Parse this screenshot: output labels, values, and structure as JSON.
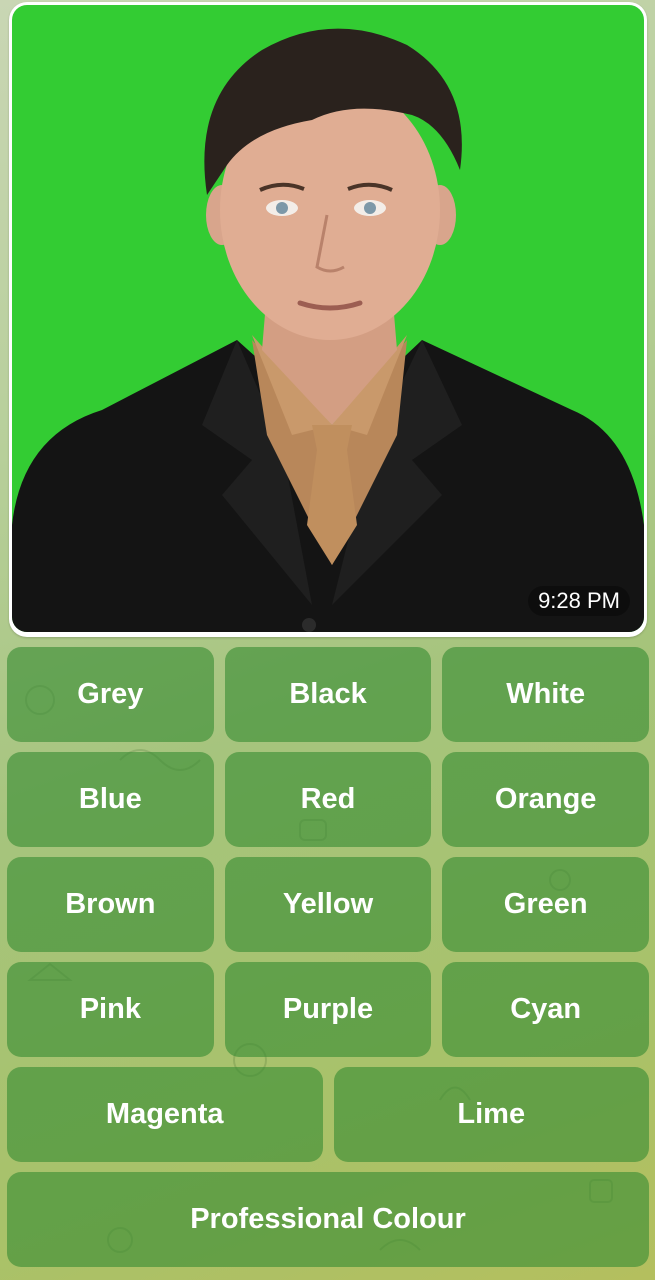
{
  "message": {
    "photo_subject": "Portrait of a man in a black suit with a tan shirt and tie on a green background",
    "background_color": "#33cc33",
    "time": "9:28 PM"
  },
  "keyboard": {
    "rows": [
      [
        "Grey",
        "Black",
        "White"
      ],
      [
        "Blue",
        "Red",
        "Orange"
      ],
      [
        "Brown",
        "Yellow",
        "Green"
      ],
      [
        "Pink",
        "Purple",
        "Cyan"
      ],
      [
        "Magenta",
        "Lime"
      ],
      [
        "Professional Colour"
      ]
    ]
  }
}
